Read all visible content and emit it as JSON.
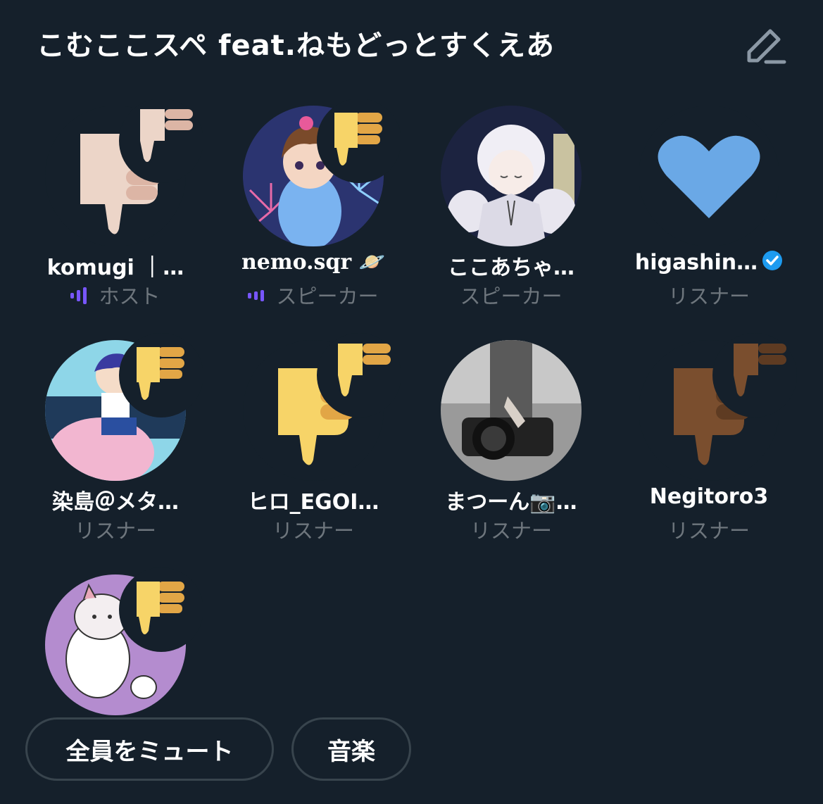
{
  "space": {
    "title": "こむここスペ feat.ねもどっとすくえあ",
    "edit_icon": "pencil-edit-icon"
  },
  "participants": [
    {
      "name": "komugi ｜…",
      "role": "ホスト",
      "speaking": true,
      "reaction": "thumbs-down-light",
      "avatar": "thumbs-down-light"
    },
    {
      "name": "nemo.sqr 🪐",
      "role": "スピーカー",
      "speaking": true,
      "reaction": "thumbs-down-yellow",
      "avatar": "anime-girl-fireworks"
    },
    {
      "name": "ここあちゃ…",
      "role": "スピーカー",
      "speaking": false,
      "reaction": "",
      "avatar": "anime-girl-roses"
    },
    {
      "name": "higashin…",
      "role": "リスナー",
      "speaking": false,
      "verified": true,
      "reaction": "",
      "avatar": "blue-heart"
    },
    {
      "name": "染島＠メタ…",
      "role": "リスナー",
      "speaking": false,
      "reaction": "thumbs-down-yellow",
      "avatar": "anime-boy-cloud"
    },
    {
      "name": "ヒロ_EGOI…",
      "role": "リスナー",
      "speaking": false,
      "reaction": "thumbs-down-yellow",
      "avatar": "thumbs-down-yellow"
    },
    {
      "name": "まつーん📷…",
      "role": "リスナー",
      "speaking": false,
      "reaction": "",
      "avatar": "camera-photo"
    },
    {
      "name": "Negitoro3",
      "role": "リスナー",
      "speaking": false,
      "reaction": "thumbs-down-dark",
      "avatar": "thumbs-down-dark"
    },
    {
      "name": "",
      "role": "",
      "speaking": false,
      "reaction": "thumbs-down-yellow",
      "avatar": "cartoon-cat-purple"
    }
  ],
  "buttons": {
    "mute_all": "全員をミュート",
    "music": "音楽"
  },
  "colors": {
    "background": "#15202b",
    "speaking_wave": "#7856ff",
    "verified": "#1d9bf0",
    "role_text": "#6e767d",
    "button_border": "#38444d"
  }
}
